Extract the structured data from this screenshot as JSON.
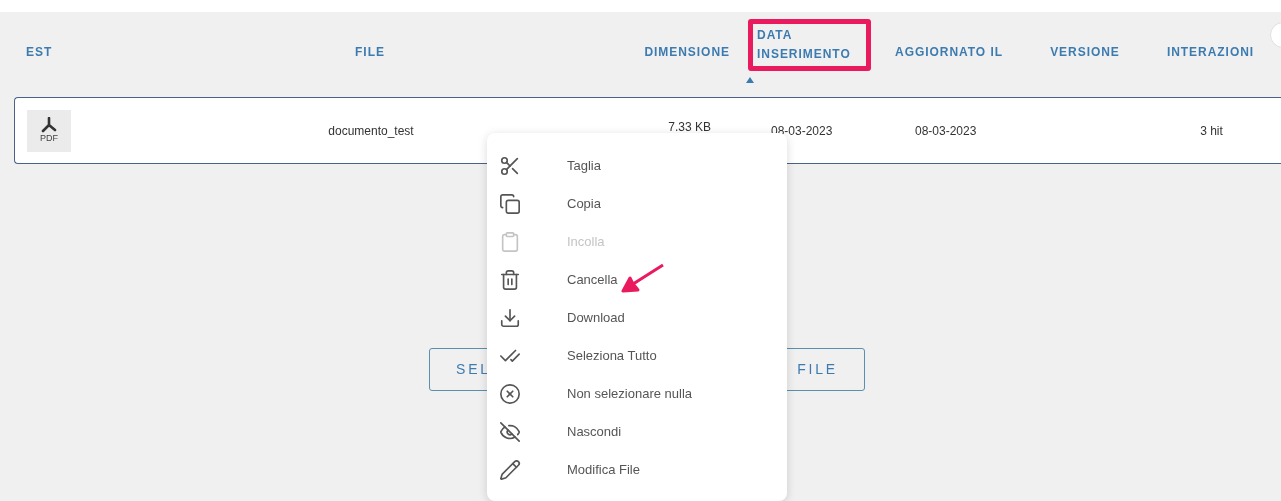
{
  "table": {
    "columns": [
      {
        "label": "EST",
        "highlighted": false,
        "sorted": false
      },
      {
        "label": "FILE",
        "highlighted": false,
        "sorted": false
      },
      {
        "label": "DIMENSIONE",
        "highlighted": false,
        "sorted": false
      },
      {
        "label": "DATA INSERIMENTO",
        "highlighted": true,
        "sorted": true
      },
      {
        "label": "AGGIORNATO IL",
        "highlighted": false,
        "sorted": false
      },
      {
        "label": "VERSIONE",
        "highlighted": false,
        "sorted": false
      },
      {
        "label": "INTERAZIONI",
        "highlighted": false,
        "sorted": false
      }
    ],
    "rows": [
      {
        "type_label": "PDF",
        "file": "documento_test",
        "size": "7.33 KB",
        "inserted": "08-03-2023",
        "updated": "08-03-2023",
        "interactions": "3 hit"
      }
    ]
  },
  "select_button": {
    "label_start": "SEL",
    "label_end": "FILE"
  },
  "context_menu": {
    "items": [
      {
        "label": "Taglia",
        "disabled": false,
        "pointed": false
      },
      {
        "label": "Copia",
        "disabled": false,
        "pointed": false
      },
      {
        "label": "Incolla",
        "disabled": true,
        "pointed": false
      },
      {
        "label": "Cancella",
        "disabled": false,
        "pointed": true
      },
      {
        "label": "Download",
        "disabled": false,
        "pointed": false
      },
      {
        "label": "Seleziona Tutto",
        "disabled": false,
        "pointed": false
      },
      {
        "label": "Non selezionare nulla",
        "disabled": false,
        "pointed": false
      },
      {
        "label": "Nascondi",
        "disabled": false,
        "pointed": false
      },
      {
        "label": "Modifica File",
        "disabled": false,
        "pointed": false
      }
    ]
  }
}
